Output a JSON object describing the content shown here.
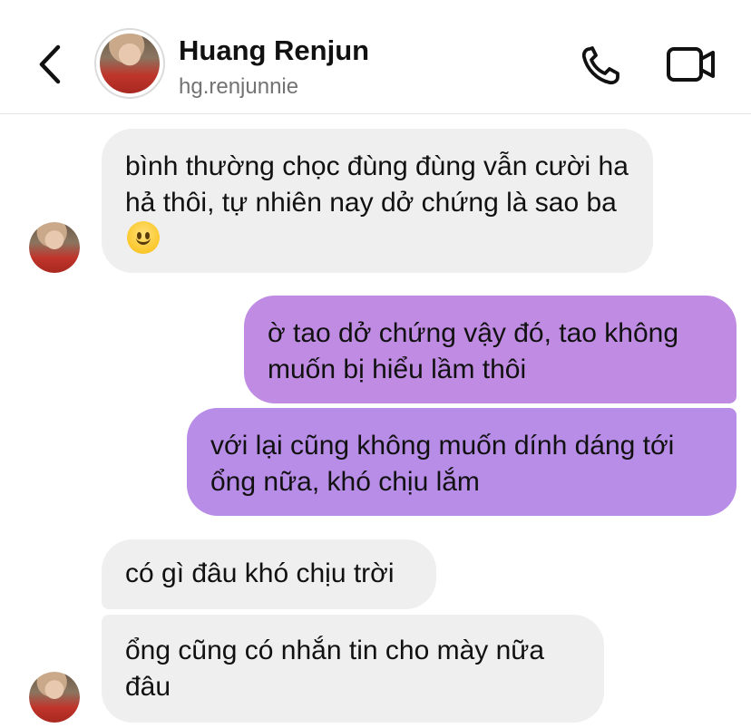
{
  "header": {
    "name": "Huang Renjun",
    "handle": "hg.renjunnie",
    "icons": [
      "back-chevron-icon",
      "phone-icon",
      "video-camera-icon"
    ]
  },
  "messages": [
    {
      "from": "them",
      "text": "bình thường chọc đùng đùng vẫn cười ha hả thôi, tự nhiên nay dở chứng là sao ba",
      "emoji": "slightly-smiling-face"
    },
    {
      "from": "me",
      "text": "ờ tao dở chứng vậy đó, tao không muốn bị hiểu lầm thôi"
    },
    {
      "from": "me",
      "text": "với lại cũng không muốn dính dáng tới ổng nữa, khó chịu lắm"
    },
    {
      "from": "them",
      "text": "có gì đâu khó chịu trời"
    },
    {
      "from": "them",
      "text": "ổng cũng có nhắn tin cho mày nữa đâu"
    }
  ],
  "colors": {
    "incoming_bubble": "#efefef",
    "outgoing_bubble_1": "#c08ce3",
    "outgoing_bubble_2": "#b88de8",
    "divider": "#e3e3e3"
  }
}
